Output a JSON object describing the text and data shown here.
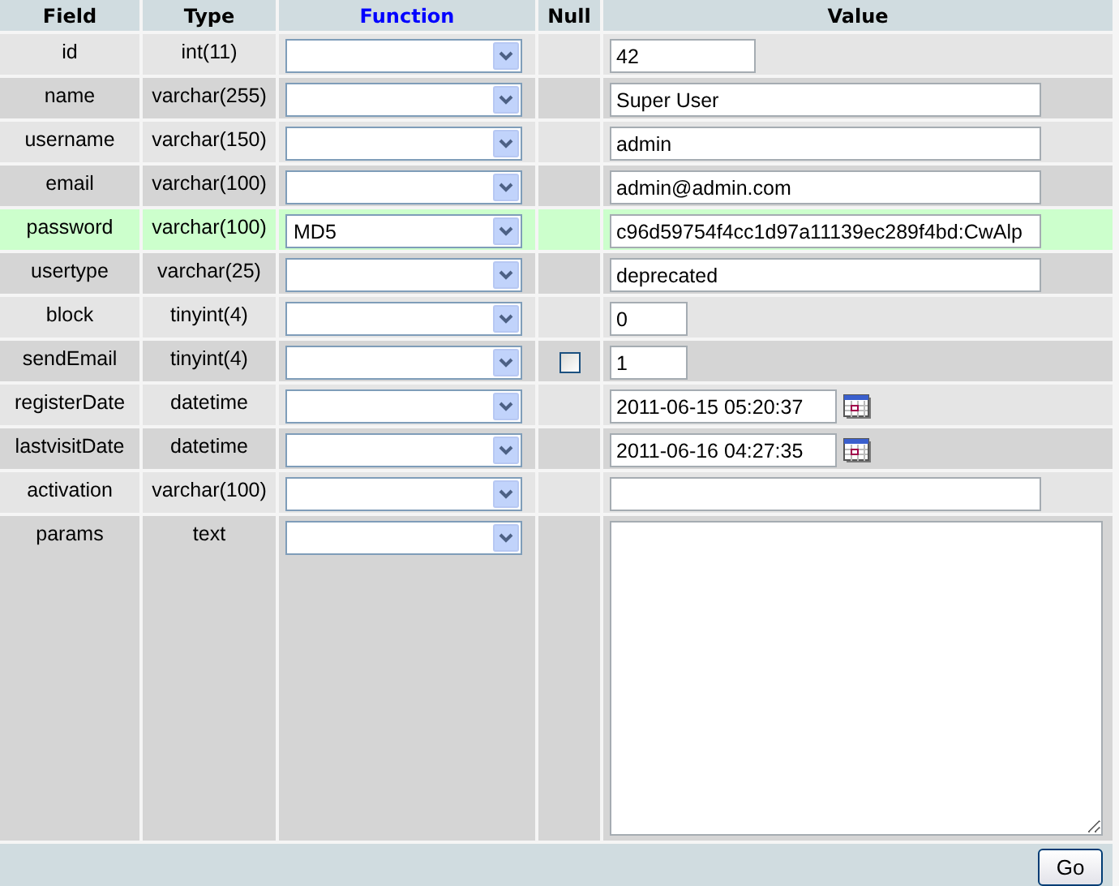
{
  "columns": [
    {
      "label": "Field",
      "link": false
    },
    {
      "label": "Type",
      "link": false
    },
    {
      "label": "Function",
      "link": true
    },
    {
      "label": "Null",
      "link": false
    },
    {
      "label": "Value",
      "link": false
    }
  ],
  "rows": [
    {
      "field": "id",
      "type": "int(11)",
      "kind": "int",
      "value": "42",
      "highlighted": false
    },
    {
      "field": "name",
      "type": "varchar(255)",
      "kind": "text",
      "value": "Super User",
      "highlighted": false
    },
    {
      "field": "username",
      "type": "varchar(150)",
      "kind": "text",
      "value": "admin",
      "highlighted": false
    },
    {
      "field": "email",
      "type": "varchar(100)",
      "kind": "text",
      "value": "admin@admin.com",
      "highlighted": false
    },
    {
      "field": "password",
      "type": "varchar(100)",
      "kind": "text",
      "function": "MD5",
      "value": "c96d59754f4cc1d97a11139ec289f4bd:CwAlp",
      "highlighted": true
    },
    {
      "field": "usertype",
      "type": "varchar(25)",
      "kind": "text",
      "value": "deprecated",
      "highlighted": false
    },
    {
      "field": "block",
      "type": "tinyint(4)",
      "kind": "tinyint",
      "value": "0",
      "highlighted": false
    },
    {
      "field": "sendEmail",
      "type": "tinyint(4)",
      "kind": "tinyint",
      "value": "1",
      "highlighted": false,
      "null_checked": false
    },
    {
      "field": "registerDate",
      "type": "datetime",
      "kind": "date",
      "value": "2011-06-15 05:20:37",
      "highlighted": false
    },
    {
      "field": "lastvisitDate",
      "type": "datetime",
      "kind": "date",
      "value": "2011-06-16 04:27:35",
      "highlighted": false
    },
    {
      "field": "activation",
      "type": "varchar(100)",
      "kind": "text",
      "highlighted": false
    },
    {
      "field": "params",
      "type": "text",
      "kind": "textarea",
      "highlighted": false
    }
  ],
  "submit": "Go"
}
